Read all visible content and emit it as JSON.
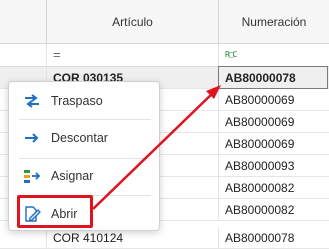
{
  "grid": {
    "columns": {
      "articulo": "Artículo",
      "numeracion": "Numeración"
    },
    "filter": {
      "articulo_operator": "=",
      "numeracion_icon": "filter-contains-icon",
      "numeracion_icon_text": "R□C"
    },
    "rows": [
      {
        "articulo": "COR 030135",
        "numeracion": "AB80000078",
        "selected": true
      },
      {
        "articulo": "",
        "numeracion": "AB80000069"
      },
      {
        "articulo": "",
        "numeracion": "AB80000069"
      },
      {
        "articulo": "",
        "numeracion": "AB80000069"
      },
      {
        "articulo": "",
        "numeracion": "AB80000093"
      },
      {
        "articulo": "",
        "numeracion": "AB80000082"
      },
      {
        "articulo": "",
        "numeracion": "AB80000082"
      },
      {
        "articulo": "COR 410124",
        "numeracion": "AB80000078"
      }
    ]
  },
  "context_menu": {
    "items": [
      {
        "label": "Traspaso",
        "icon": "transfer-arrows-icon"
      },
      {
        "label": "Descontar",
        "icon": "arrow-right-icon"
      },
      {
        "label": "Asignar",
        "icon": "assign-icon"
      },
      {
        "label": "Abrir",
        "icon": "edit-document-icon"
      }
    ]
  },
  "colors": {
    "annotation": "#e0141e",
    "icon_blue": "#1f6fc5",
    "selected_row": "#efefef"
  }
}
